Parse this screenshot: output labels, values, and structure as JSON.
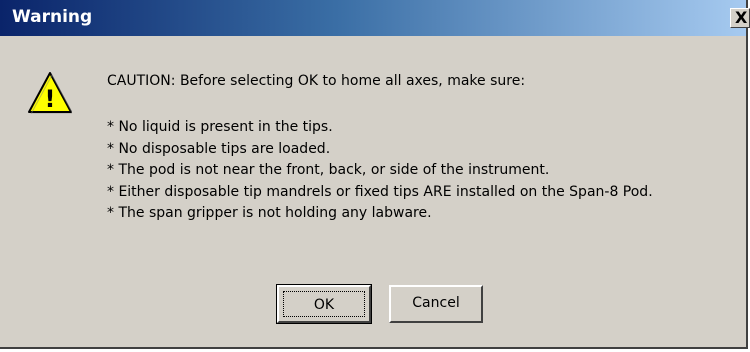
{
  "window": {
    "title": "Warning",
    "close_glyph": "X"
  },
  "icon": {
    "name": "warning-icon",
    "fill": "#ffff00",
    "symbol": "!"
  },
  "message": {
    "caution": "CAUTION: Before selecting OK to home all axes, make sure:",
    "bullets": [
      "* No liquid is present in the tips.",
      "* No disposable tips are loaded.",
      "* The pod is not near the front, back, or side of the instrument.",
      "* Either disposable tip mandrels or fixed tips ARE installed on the Span-8 Pod.",
      "* The span gripper is not holding any labware."
    ]
  },
  "buttons": {
    "ok_label": "OK",
    "cancel_label": "Cancel"
  },
  "colors": {
    "titlebar_start": "#0a246a",
    "titlebar_end": "#a6caf0",
    "dialog_bg": "#d4d0c8"
  }
}
